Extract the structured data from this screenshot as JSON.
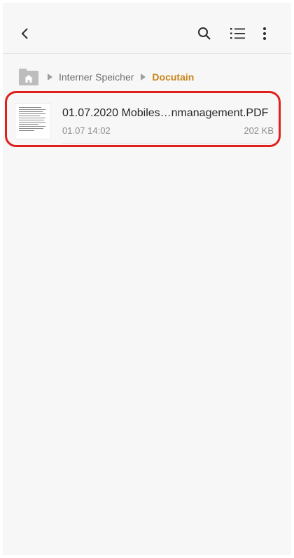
{
  "topbar": {
    "back_icon": "chevron-left-icon",
    "search_icon": "search-icon",
    "list_icon": "list-view-icon",
    "more_icon": "more-vertical-icon"
  },
  "breadcrumb": {
    "home_icon": "home-folder-icon",
    "items": [
      "Interner Speicher",
      "Docutain"
    ],
    "current_color": "#c8851a"
  },
  "files": [
    {
      "name": "01.07.2020 Mobiles…nmanagement.PDF",
      "date": "01.07 14:02",
      "size": "202 KB",
      "thumb_icon": "pdf-document-thumbnail"
    }
  ],
  "highlight_color": "#e0201c"
}
